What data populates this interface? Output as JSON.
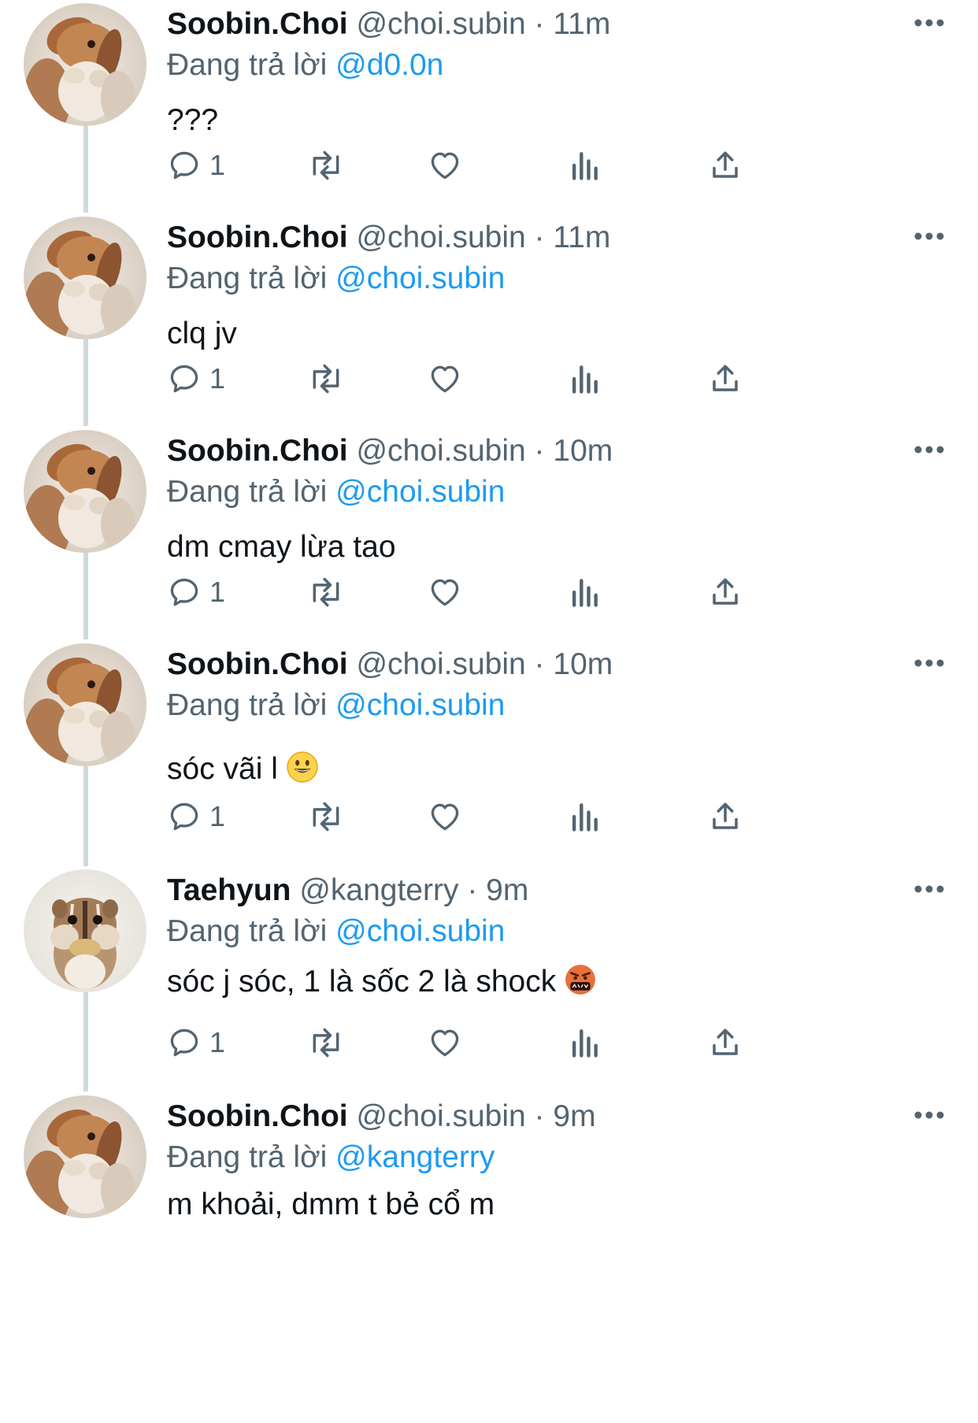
{
  "tweets": [
    {
      "name": "Soobin.Choi",
      "handle": "@choi.subin",
      "dot": "·",
      "time": "11m",
      "reply_label": "Đang trả lời",
      "reply_to": "@d0.0n",
      "text": "???",
      "reply_count": "1",
      "avatar_icon": "bunny-avatar-icon",
      "emoji": ""
    },
    {
      "name": "Soobin.Choi",
      "handle": "@choi.subin",
      "dot": "·",
      "time": "11m",
      "reply_label": "Đang trả lời",
      "reply_to": "@choi.subin",
      "text": "clq jv",
      "reply_count": "1",
      "avatar_icon": "bunny-avatar-icon",
      "emoji": ""
    },
    {
      "name": "Soobin.Choi",
      "handle": "@choi.subin",
      "dot": "·",
      "time": "10m",
      "reply_label": "Đang trả lời",
      "reply_to": "@choi.subin",
      "text": "dm cmay lừa tao",
      "reply_count": "1",
      "avatar_icon": "bunny-avatar-icon",
      "emoji": ""
    },
    {
      "name": "Soobin.Choi",
      "handle": "@choi.subin",
      "dot": "·",
      "time": "10m",
      "reply_label": "Đang trả lời",
      "reply_to": "@choi.subin",
      "text": "sóc vãi l",
      "reply_count": "1",
      "avatar_icon": "bunny-avatar-icon",
      "emoji": "smiling-face-emoji"
    },
    {
      "name": "Taehyun",
      "handle": "@kangterry",
      "dot": "·",
      "time": "9m",
      "reply_label": "Đang trả lời",
      "reply_to": "@choi.subin",
      "text": "sóc j sóc, 1 là sốc 2 là shock",
      "reply_count": "1",
      "avatar_icon": "chipmunk-avatar-icon",
      "emoji": "cursing-face-emoji"
    },
    {
      "name": "Soobin.Choi",
      "handle": "@choi.subin",
      "dot": "·",
      "time": "9m",
      "reply_label": "Đang trả lời",
      "reply_to": "@kangterry",
      "text": "m khoải, dmm t bẻ cổ m",
      "reply_count": "",
      "avatar_icon": "bunny-avatar-icon",
      "emoji": ""
    }
  ],
  "colors": {
    "text": "#0f1419",
    "secondary": "#536471",
    "link": "#1d9bf0",
    "thread_line": "#cfd9de"
  },
  "icons": {
    "reply": "reply-icon",
    "retweet": "retweet-icon",
    "like": "heart-icon",
    "views": "views-icon",
    "share": "share-icon",
    "more": "more-icon"
  }
}
